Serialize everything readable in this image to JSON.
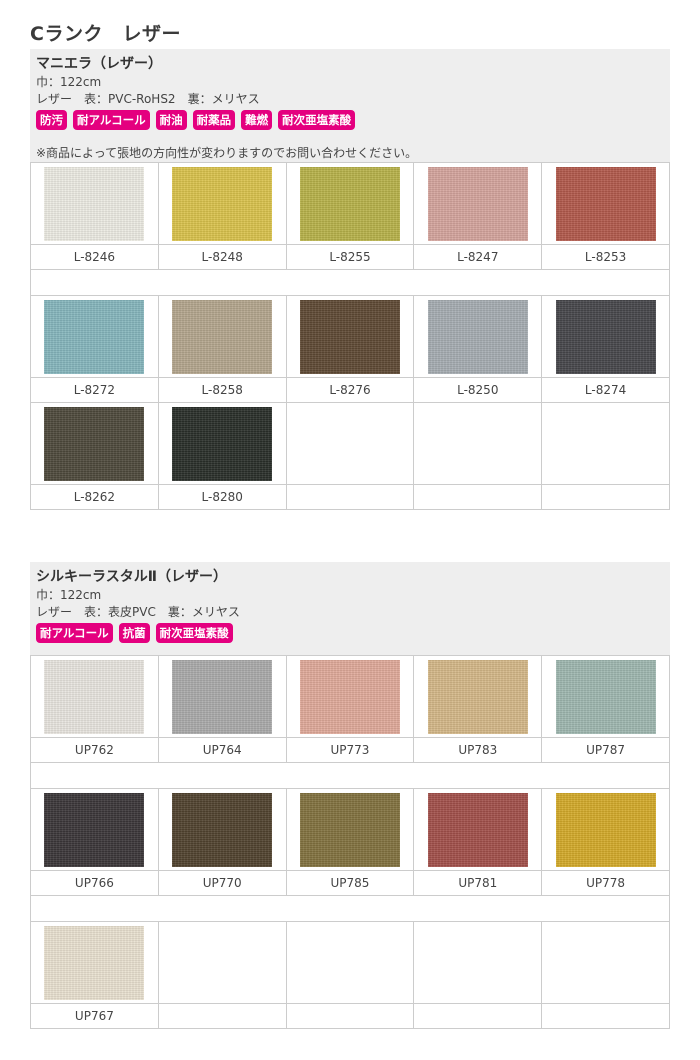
{
  "page": {
    "title": "Cランク　レザー"
  },
  "sections": [
    {
      "name": "マニエラ（レザー）",
      "width": "巾：122cm",
      "spec": "レザー　表：PVC-RoHS2　裏：メリヤス",
      "badges": [
        "防汚",
        "耐アルコール",
        "耐油",
        "耐薬品",
        "難燃",
        "耐次亜塩素酸"
      ],
      "note": "※商品によって張地の方向性が変わりますのでお問い合わせください。",
      "rows": [
        [
          {
            "code": "L-8246",
            "color": "#ecebe3"
          },
          {
            "code": "L-8248",
            "color": "#d9c24c"
          },
          {
            "code": "L-8255",
            "color": "#b7b24a"
          },
          {
            "code": "L-8247",
            "color": "#d4a49d"
          },
          {
            "code": "L-8253",
            "color": "#b25a4c"
          }
        ],
        [
          {
            "code": "L-8272",
            "color": "#86b6bd"
          },
          {
            "code": "L-8258",
            "color": "#b4a68e"
          },
          {
            "code": "L-8276",
            "color": "#5f4a35"
          },
          {
            "code": "L-8250",
            "color": "#a6adb2"
          },
          {
            "code": "L-8274",
            "color": "#47474b"
          }
        ],
        [
          {
            "code": "L-8262",
            "color": "#4e4a3c"
          },
          {
            "code": "L-8280",
            "color": "#2a2f2a"
          }
        ]
      ]
    },
    {
      "name": "シルキーラスタルⅡ（レザー）",
      "width": "巾：122cm",
      "spec": "レザー　表：表皮PVC　裏：メリヤス",
      "badges": [
        "耐アルコール",
        "抗菌",
        "耐次亜塩素酸"
      ],
      "rows": [
        [
          {
            "code": "UP762",
            "color": "#e8e5df"
          },
          {
            "code": "UP764",
            "color": "#ababab"
          },
          {
            "code": "UP773",
            "color": "#e0aa9a"
          },
          {
            "code": "UP783",
            "color": "#d4b888"
          },
          {
            "code": "UP787",
            "color": "#9fb7b0"
          }
        ],
        [
          {
            "code": "UP766",
            "color": "#3b3739"
          },
          {
            "code": "UP770",
            "color": "#51432f"
          },
          {
            "code": "UP785",
            "color": "#82723f"
          },
          {
            "code": "UP781",
            "color": "#a2504b"
          },
          {
            "code": "UP778",
            "color": "#d3aa2a"
          }
        ],
        [
          {
            "code": "UP767",
            "color": "#e9e1d0"
          }
        ]
      ]
    }
  ]
}
